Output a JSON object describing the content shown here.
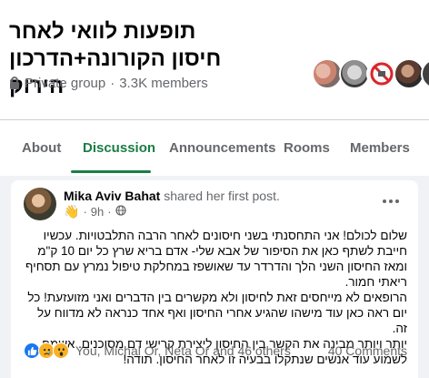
{
  "group": {
    "title": "תופעות לוואי לאחר חיסון הקורונה+הדרכון הירוק",
    "privacy": "Private group",
    "separator": "·",
    "members": "3.3K members"
  },
  "tabs": [
    {
      "label": "About"
    },
    {
      "label": "Discussion",
      "active": true
    },
    {
      "label": "Announcements"
    },
    {
      "label": "Rooms"
    },
    {
      "label": "Members"
    }
  ],
  "post": {
    "author": "Mika Aviv Bahat",
    "action": "shared her first post.",
    "time": "9h",
    "separator": "·",
    "paragraphs": [
      "שלום לכולם! אני התחסנתי בשני חיסונים לאחר הרבה התלבטויות. עכשיו חייבת לשתף כאן את הסיפור של אבא שלי- אדם בריא שרץ כל יום 10 ק\"מ ומאז החיסון השני הלך והדרדר עד שאושפז במחלקת טיפול נמרץ עם תסחיף ריאתי חמור.",
      "הרופאים לא מייחסים זאת לחיסון ולא מקשרים בין הדברים ואני מזועזעת! כל יום ראה כאן עוד מישהו שהגיע אחרי החיסון ואף אחד כנראה לא מדווח על זה.",
      "יותר ויותר מבינה את הקשר בין החיסון ליצירת קרישי דם מסוכנים. אשמח לשמוע עוד אנשים שנתקלו בבעיה זו לאחר החיסון. תודה!"
    ],
    "reactions_text": "You, Michal Or, Neta Or and 46 others",
    "comments": "40 Comments"
  },
  "colors": {
    "accent": "#1b7d45",
    "secondary_text": "#65676b",
    "page_bg": "#f0f2f5",
    "like": "#1877f2",
    "emoji": "#f7b125"
  },
  "icons": [
    "lock-icon",
    "wave-icon",
    "globe-icon",
    "more-options-icon",
    "like-reaction-icon",
    "sad-reaction-icon",
    "wow-reaction-icon"
  ]
}
